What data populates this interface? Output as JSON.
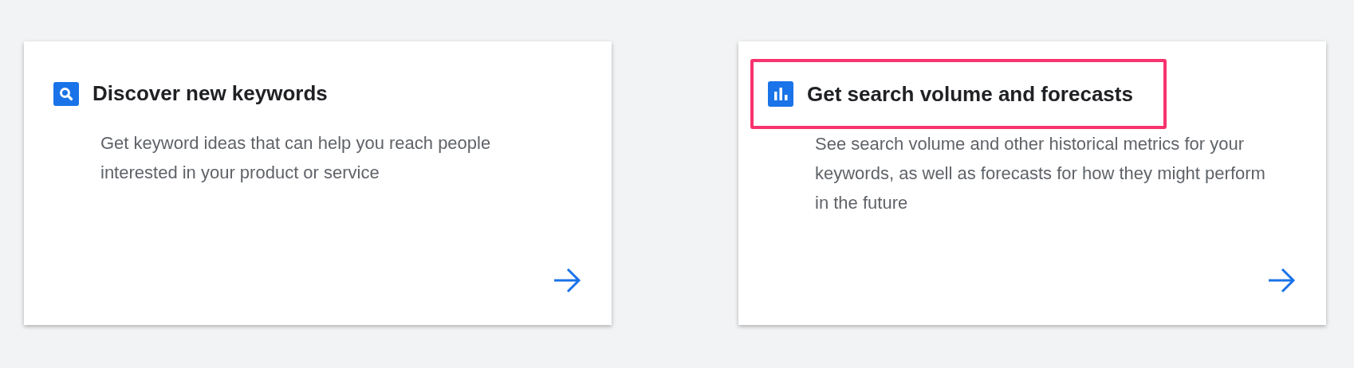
{
  "cards": [
    {
      "kind": "search",
      "title": "Discover new keywords",
      "description": "Get keyword ideas that can help you reach people interested in your product or service",
      "highlighted": false
    },
    {
      "kind": "chart",
      "title": "Get search volume and forecasts",
      "description": "See search volume and other historical metrics for your keywords, as well as forecasts for how they might perform in the future",
      "highlighted": true
    }
  ]
}
